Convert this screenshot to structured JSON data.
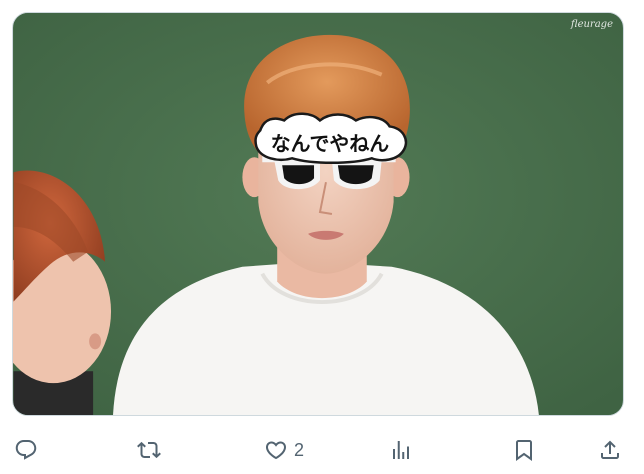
{
  "media": {
    "watermark": "fleurage",
    "glasses_text": "なんでやねん"
  },
  "actions": {
    "reply": {
      "icon": "reply-icon",
      "count": ""
    },
    "retweet": {
      "icon": "retweet-icon",
      "count": ""
    },
    "like": {
      "icon": "heart-icon",
      "count": "2"
    },
    "views": {
      "icon": "views-icon",
      "count": ""
    },
    "bookmark": {
      "icon": "bookmark-icon",
      "count": ""
    },
    "share": {
      "icon": "share-icon",
      "count": ""
    }
  },
  "colors": {
    "background": "#ffffff",
    "icon_gray": "#536471",
    "photo_backdrop": "#4a6e4c"
  }
}
